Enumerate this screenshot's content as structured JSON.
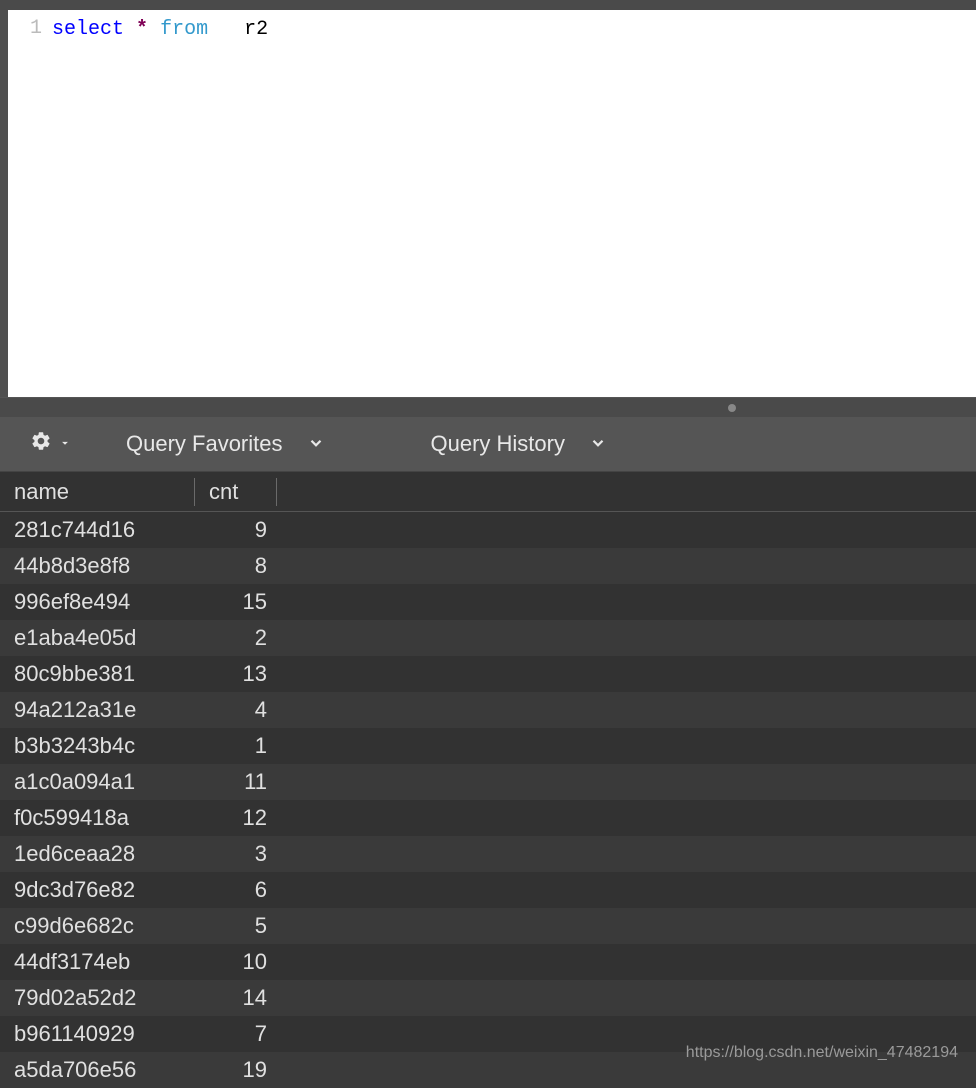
{
  "editor": {
    "line_number": "1",
    "tokens": {
      "select": "select",
      "star": "*",
      "from": "from",
      "table": "r2"
    }
  },
  "toolbar": {
    "query_favorites": "Query Favorites",
    "query_history": "Query History"
  },
  "table": {
    "columns": {
      "name": "name",
      "cnt": "cnt"
    },
    "rows": [
      {
        "name": "281c744d16",
        "cnt": "9"
      },
      {
        "name": "44b8d3e8f8",
        "cnt": "8"
      },
      {
        "name": "996ef8e494",
        "cnt": "15"
      },
      {
        "name": "e1aba4e05d",
        "cnt": "2"
      },
      {
        "name": "80c9bbe381",
        "cnt": "13"
      },
      {
        "name": "94a212a31e",
        "cnt": "4"
      },
      {
        "name": "b3b3243b4c",
        "cnt": "1"
      },
      {
        "name": "a1c0a094a1",
        "cnt": "11"
      },
      {
        "name": "f0c599418a",
        "cnt": "12"
      },
      {
        "name": "1ed6ceaa28",
        "cnt": "3"
      },
      {
        "name": "9dc3d76e82",
        "cnt": "6"
      },
      {
        "name": "c99d6e682c",
        "cnt": "5"
      },
      {
        "name": "44df3174eb",
        "cnt": "10"
      },
      {
        "name": "79d02a52d2",
        "cnt": "14"
      },
      {
        "name": "b961140929",
        "cnt": "7"
      },
      {
        "name": "a5da706e56",
        "cnt": "19"
      }
    ]
  },
  "watermark": "https://blog.csdn.net/weixin_47482194"
}
